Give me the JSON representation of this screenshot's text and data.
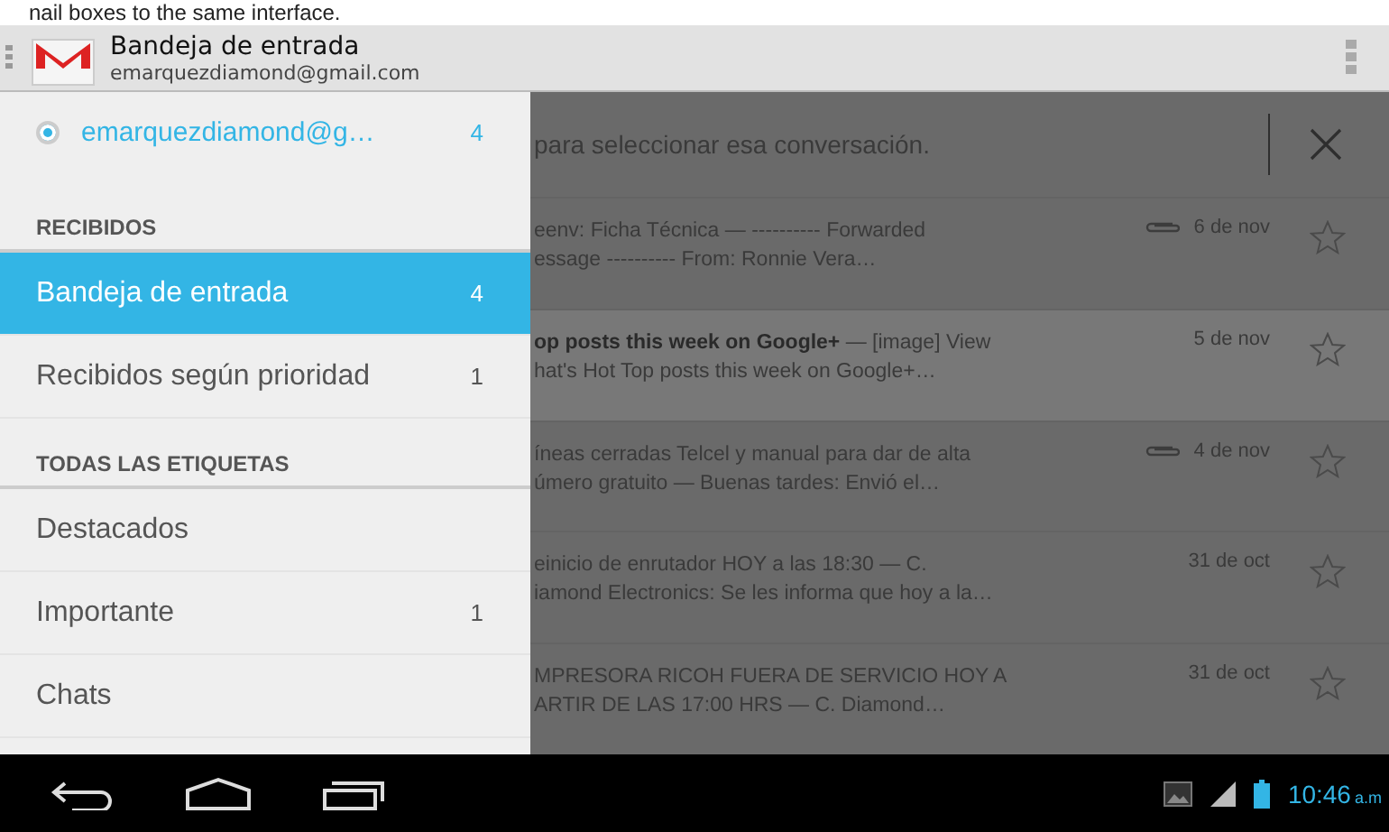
{
  "caption": "nail boxes to the same interface.",
  "header": {
    "title": "Bandeja de entrada",
    "account": "emarquezdiamond@gmail.com"
  },
  "drawer": {
    "account": {
      "label": "emarquezdiamond@g…",
      "count": "4",
      "selected": true
    },
    "sections": [
      {
        "heading": "RECIBIDOS",
        "items": [
          {
            "label": "Bandeja de entrada",
            "count": "4",
            "selected": true
          },
          {
            "label": "Recibidos según prioridad",
            "count": "1",
            "selected": false
          }
        ]
      },
      {
        "heading": "TODAS LAS ETIQUETAS",
        "items": [
          {
            "label": "Destacados",
            "selected": false
          },
          {
            "label": "Importante",
            "count": "1",
            "selected": false
          },
          {
            "label": "Chats",
            "selected": false
          }
        ]
      }
    ]
  },
  "undo_bar": {
    "text": "para seleccionar esa conversación."
  },
  "messages": [
    {
      "line1": "eenv: Ficha Técnica — ---------- Forwarded",
      "line2": "essage ---------- From: Ronnie Vera…",
      "date": "6 de nov",
      "attachment": true,
      "unread": false,
      "starred": false
    },
    {
      "line1": "**op posts this week on Google+** — [image] View",
      "line2": "hat's Hot Top posts this week on Google+…",
      "date": "5 de nov",
      "attachment": false,
      "unread": true,
      "starred": false
    },
    {
      "line1": "íneas cerradas Telcel y manual para dar de alta",
      "line2": "úmero gratuito — Buenas tardes: Envió el…",
      "date": "4 de nov",
      "attachment": true,
      "unread": false,
      "starred": false
    },
    {
      "line1": "einicio de enrutador HOY a las 18:30 — C.",
      "line2": "iamond Electronics: Se les informa que hoy a la…",
      "date": "31 de oct",
      "attachment": false,
      "unread": false,
      "starred": false
    },
    {
      "line1": "MPRESORA RICOH FUERA DE SERVICIO HOY A",
      "line2": "ARTIR DE LAS 17:00 HRS — C. Diamond…",
      "date": "31 de oct",
      "attachment": false,
      "unread": false,
      "starred": false
    }
  ],
  "status": {
    "time": "10:46",
    "ampm": "a.m"
  }
}
